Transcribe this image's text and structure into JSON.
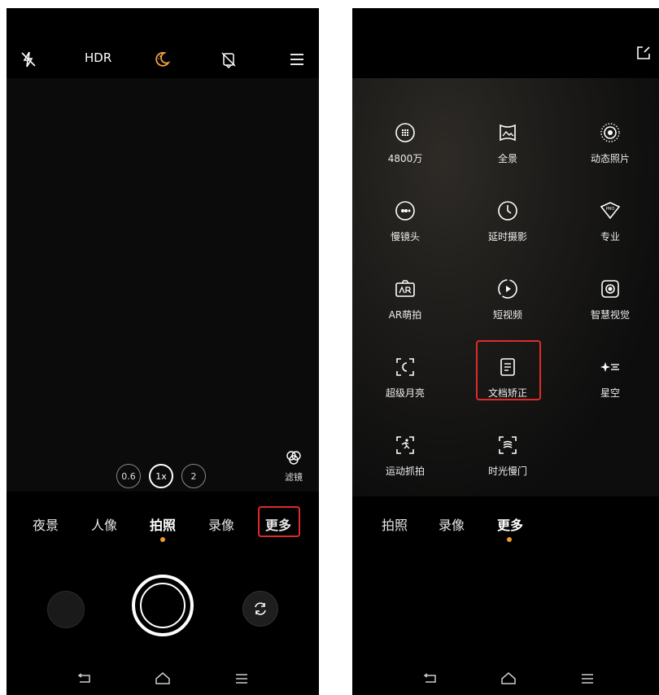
{
  "left": {
    "topbar": {
      "hdr_label": "HDR"
    },
    "zoom": {
      "options": [
        "0.6",
        "1x",
        "2"
      ]
    },
    "filter_label": "滤镜",
    "modes": [
      "夜景",
      "人像",
      "拍照",
      "录像",
      "更多"
    ],
    "active_mode": "拍照",
    "highlighted_mode": "更多"
  },
  "right": {
    "grid": [
      {
        "label": "4800万",
        "icon": "megapixel-icon"
      },
      {
        "label": "全景",
        "icon": "panorama-icon"
      },
      {
        "label": "动态照片",
        "icon": "live-photo-icon"
      },
      {
        "label": "慢镜头",
        "icon": "slow-motion-icon"
      },
      {
        "label": "延时摄影",
        "icon": "timelapse-icon"
      },
      {
        "label": "专业",
        "icon": "pro-icon"
      },
      {
        "label": "AR萌拍",
        "icon": "ar-icon"
      },
      {
        "label": "短视频",
        "icon": "short-video-icon"
      },
      {
        "label": "智慧视觉",
        "icon": "smart-vision-icon"
      },
      {
        "label": "超级月亮",
        "icon": "super-moon-icon"
      },
      {
        "label": "文档矫正",
        "icon": "document-icon"
      },
      {
        "label": "星空",
        "icon": "starry-sky-icon"
      },
      {
        "label": "运动抓拍",
        "icon": "sport-capture-icon"
      },
      {
        "label": "时光慢门",
        "icon": "slow-shutter-icon"
      }
    ],
    "modes": [
      "拍照",
      "录像",
      "更多"
    ],
    "active_mode": "更多",
    "highlighted_item": "文档矫正"
  },
  "colors": {
    "accent": "#f49b2c",
    "highlight": "#e02a2a",
    "night_icon": "#f0a040"
  }
}
